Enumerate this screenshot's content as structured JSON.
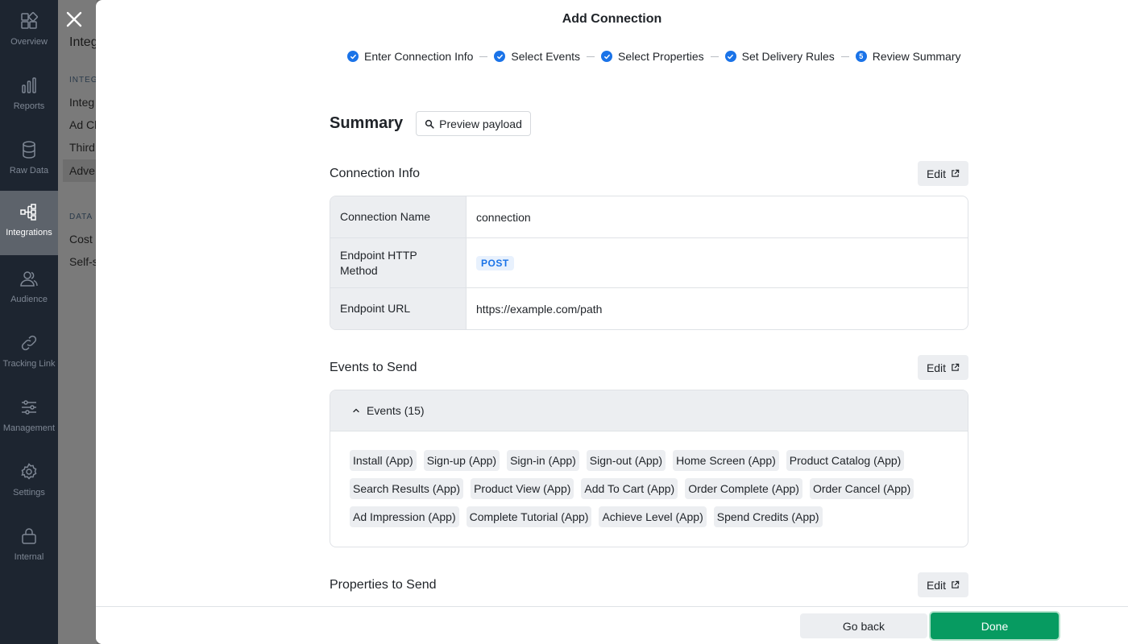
{
  "sidebar": {
    "items": [
      {
        "label": "Overview",
        "icon": "overview-icon"
      },
      {
        "label": "Reports",
        "icon": "bar-chart-icon"
      },
      {
        "label": "Raw Data",
        "icon": "database-icon"
      },
      {
        "label": "Integrations",
        "icon": "integrations-icon",
        "active": true
      },
      {
        "label": "Audience",
        "icon": "users-icon"
      },
      {
        "label": "Tracking Link",
        "icon": "link-icon"
      },
      {
        "label": "Management",
        "icon": "sliders-icon"
      },
      {
        "label": "Settings",
        "icon": "gear-icon"
      },
      {
        "label": "Internal",
        "icon": "lock-icon"
      }
    ]
  },
  "underlying": {
    "title": "Integ",
    "section1": "INTEG",
    "items1": [
      "Integ",
      "Ad Cl",
      "Third",
      "Adve"
    ],
    "section2": "DATA I",
    "items2": [
      "Cost",
      "Self-s"
    ]
  },
  "modal": {
    "title": "Add Connection",
    "steps": [
      {
        "label": "Enter Connection Info",
        "status": "done"
      },
      {
        "label": "Select Events",
        "status": "done"
      },
      {
        "label": "Select Properties",
        "status": "done"
      },
      {
        "label": "Set Delivery Rules",
        "status": "done"
      },
      {
        "label": "Review Summary",
        "status": "current",
        "number": "5"
      }
    ],
    "summary_title": "Summary",
    "preview_label": "Preview payload",
    "edit_label": "Edit",
    "connection_info": {
      "title": "Connection Info",
      "rows": [
        {
          "key": "Connection Name",
          "value": "connection"
        },
        {
          "key": "Endpoint HTTP Method",
          "value": "POST"
        },
        {
          "key": "Endpoint URL",
          "value": "https://example.com/path"
        }
      ]
    },
    "events": {
      "title": "Events to Send",
      "header": "Events (15)",
      "chip_rows": [
        [
          "Install (App)",
          "Sign-up (App)",
          "Sign-in (App)",
          "Sign-out (App)",
          "Home Screen (App)",
          "Product Catalog (App)"
        ],
        [
          "Search Results (App)",
          "Product View (App)",
          "Add To Cart (App)",
          "Order Complete (App)",
          "Order Cancel (App)"
        ],
        [
          "Ad Impression (App)",
          "Complete Tutorial (App)",
          "Achieve Level (App)",
          "Spend Credits (App)"
        ]
      ]
    },
    "properties": {
      "title": "Properties to Send"
    },
    "footer": {
      "back_label": "Go back",
      "done_label": "Done"
    }
  },
  "colors": {
    "accent_blue": "#1a73e8",
    "done_green": "#079b61",
    "rail_bg": "#1d2530"
  }
}
